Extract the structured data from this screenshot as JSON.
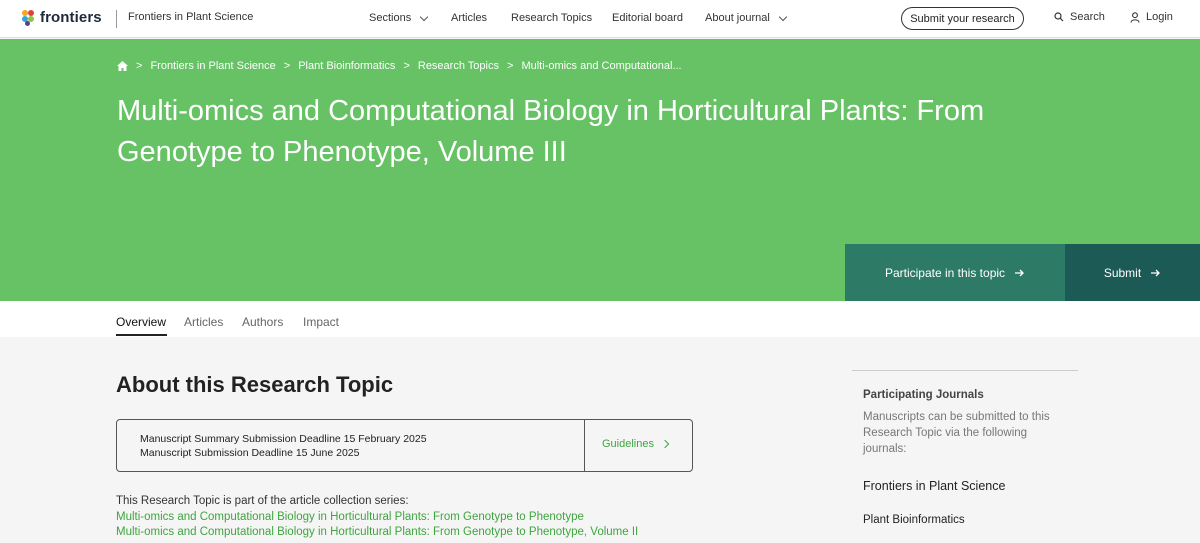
{
  "header": {
    "logo_text": "frontiers",
    "journal": "Frontiers in Plant Science",
    "nav": [
      {
        "label": "Sections",
        "dropdown": true
      },
      {
        "label": "Articles",
        "dropdown": false
      },
      {
        "label": "Research Topics",
        "dropdown": false
      },
      {
        "label": "Editorial board",
        "dropdown": false
      },
      {
        "label": "About journal",
        "dropdown": true
      }
    ],
    "submit_label": "Submit your research",
    "search_label": "Search",
    "login_label": "Login"
  },
  "hero": {
    "breadcrumb": [
      "Frontiers in Plant Science",
      "Plant Bioinformatics",
      "Research Topics",
      "Multi-omics and Computational..."
    ],
    "title": "Multi-omics and Computational Biology in Horticultural Plants: From Genotype to Phenotype, Volume III",
    "participate_label": "Participate in this topic",
    "submit_label": "Submit",
    "colors": {
      "hero_bg": "#66c265",
      "participate_bg": "#2d7a66",
      "submit_bg": "#1b5a55"
    }
  },
  "tabs": [
    "Overview",
    "Articles",
    "Authors",
    "Impact"
  ],
  "main": {
    "section_title": "About this Research Topic",
    "deadline_summary": "Manuscript Summary Submission Deadline 15 February 2025",
    "deadline_manuscript": "Manuscript Submission Deadline 15 June 2025",
    "guidelines_label": "Guidelines",
    "series_intro": "This Research Topic is part of the article collection series:",
    "series_links": [
      "Multi-omics and Computational Biology in Horticultural Plants: From Genotype to Phenotype",
      "Multi-omics and Computational Biology in Horticultural Plants: From Genotype to Phenotype, Volume II"
    ]
  },
  "sidebar": {
    "heading": "Participating Journals",
    "description": "Manuscripts can be submitted to this Research Topic via the following journals:",
    "journal": "Frontiers in Plant Science",
    "section": "Plant Bioinformatics"
  }
}
